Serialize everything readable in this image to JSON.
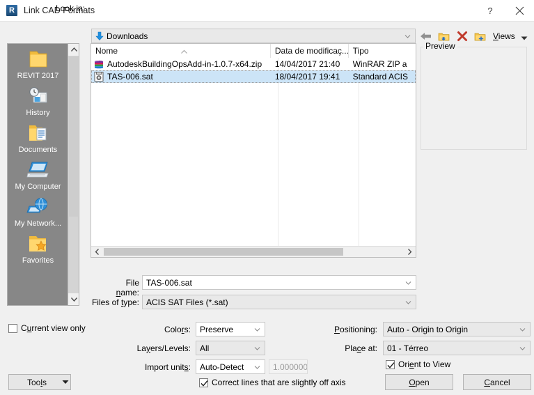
{
  "window": {
    "title": "Link CAD Formats",
    "logo_text": "R",
    "help_label": "?",
    "close_label": "✕"
  },
  "lookin": {
    "label": "Look in:",
    "value": "Downloads",
    "icon": "download-arrow-icon"
  },
  "toolbar": {
    "back_icon": "back-arrow-icon",
    "up_icon": "up-folder-icon",
    "delete_icon": "delete-x-icon",
    "new_folder_icon": "new-folder-icon",
    "views_label": "Views",
    "views_caret_icon": "chevron-down-icon"
  },
  "preview": {
    "legend": "Preview"
  },
  "places": {
    "items": [
      {
        "label": "REVIT 2017",
        "icon": "folder-icon"
      },
      {
        "label": "History",
        "icon": "history-clock-icon"
      },
      {
        "label": "Documents",
        "icon": "documents-folder-icon"
      },
      {
        "label": "My Computer",
        "icon": "computer-icon"
      },
      {
        "label": "My Network...",
        "icon": "network-icon"
      },
      {
        "label": "Favorites",
        "icon": "favorites-star-folder-icon"
      }
    ]
  },
  "filelist": {
    "columns": [
      "Nome",
      "Data de modificaç...",
      "Tipo"
    ],
    "sort_indicator": "ascending",
    "rows": [
      {
        "name": "AutodeskBuildingOpsAdd-in-1.0.7-x64.zip",
        "date": "14/04/2017 21:40",
        "type": "WinRAR ZIP a",
        "icon": "winrar-archive-icon",
        "selected": false
      },
      {
        "name": "TAS-006.sat",
        "date": "18/04/2017 19:41",
        "type": "Standard ACIS",
        "icon": "sat-file-icon",
        "selected": true
      }
    ]
  },
  "form": {
    "filename_label": "File name:",
    "filename_value": "TAS-006.sat",
    "filetype_label": "Files of type:",
    "filetype_value": "ACIS SAT Files  (*.sat)"
  },
  "options": {
    "current_view_only_label": "Current view only",
    "current_view_only_checked": false,
    "colors_label": "Colors:",
    "colors_value": "Preserve",
    "layers_label": "Layers/Levels:",
    "layers_value": "All",
    "units_label": "Import units:",
    "units_value": "Auto-Detect",
    "scale_value": "1.000000",
    "correct_lines_label": "Correct lines that are slightly off axis",
    "correct_lines_checked": true,
    "positioning_label": "Positioning:",
    "positioning_value": "Auto - Origin to Origin",
    "placeat_label": "Place at:",
    "placeat_value": "01 - Térreo",
    "orient_to_view_label": "Orient to View",
    "orient_to_view_checked": true
  },
  "buttons": {
    "tools_label": "Tools",
    "open_label": "Open",
    "cancel_label": "Cancel"
  },
  "colors": {
    "selection": "#cce4f7",
    "places_bg": "#878787",
    "dialog_bg": "#f0f0f0",
    "accent_blue": "#1f7ec4"
  }
}
